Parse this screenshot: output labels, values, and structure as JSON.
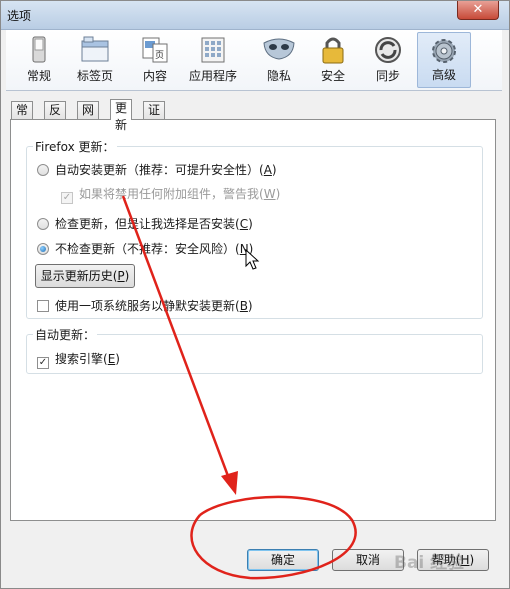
{
  "window": {
    "title": "选项",
    "close_glyph": "✕"
  },
  "toolbar": {
    "items": [
      {
        "label": "常规",
        "icon": "switch-icon"
      },
      {
        "label": "标签页",
        "icon": "tabs-window-icon"
      },
      {
        "label": "内容",
        "icon": "content-page-icon"
      },
      {
        "label": "应用程序",
        "icon": "applications-icon"
      },
      {
        "label": "隐私",
        "icon": "mask-icon"
      },
      {
        "label": "安全",
        "icon": "padlock-icon"
      },
      {
        "label": "同步",
        "icon": "sync-icon"
      },
      {
        "label": "高级",
        "icon": "gear-icon"
      }
    ],
    "selected": "高级"
  },
  "tabs": {
    "items": [
      "常规",
      "反馈",
      "网络",
      "更新",
      "证书"
    ],
    "selected": "更新"
  },
  "firefox_update": {
    "legend": "Firefox 更新：",
    "auto_install": {
      "text": "自动安装更新（推荐：可提升安全性）(",
      "key": "A",
      "tail": ")",
      "checked": false
    },
    "warn_addons": {
      "text": "如果将禁用任何附加组件，警告我(",
      "key": "W",
      "tail": ")",
      "checked": true,
      "disabled": true
    },
    "check_only": {
      "text": "检查更新，但是让我选择是否安装(",
      "key": "C",
      "tail": ")",
      "checked": false
    },
    "never_check": {
      "text": "不检查更新（不推荐：安全风险）(",
      "key": "N",
      "tail": ")",
      "checked": true
    },
    "history_button": {
      "text": "显示更新历史(",
      "key": "P",
      "tail": ")"
    },
    "background_service": {
      "text": "使用一项系统服务以静默安装更新(",
      "key": "B",
      "tail": ")",
      "checked": false
    }
  },
  "auto_update": {
    "legend": "自动更新：",
    "search_engines": {
      "text": "搜索引擎(",
      "key": "E",
      "tail": ")",
      "checked": true
    }
  },
  "footer": {
    "ok": "确定",
    "cancel": "取消",
    "help": {
      "text": "帮助(",
      "key": "H",
      "tail": ")"
    }
  },
  "annotation_color": "#e0231b",
  "watermark": "Bai 经验"
}
